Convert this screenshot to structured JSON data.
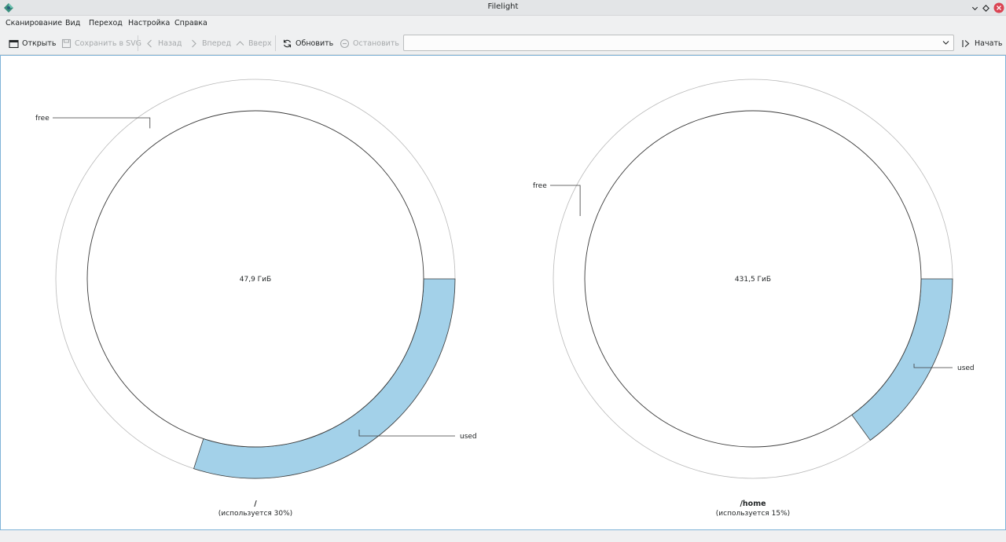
{
  "window": {
    "title": "Filelight",
    "icons": {
      "app": "filelight-app-icon",
      "minimize": "chevron-down-icon",
      "maximize": "diamond-icon",
      "close": "close-icon"
    }
  },
  "menu": {
    "items": [
      "Сканирование",
      "Вид",
      "Переход",
      "Настройка",
      "Справка"
    ]
  },
  "toolbar": {
    "open": "Открыть",
    "save_svg": "Сохранить в SVG",
    "back": "Назад",
    "forward": "Вперед",
    "up": "Вверх",
    "refresh": "Обновить",
    "stop": "Остановить",
    "start": "Начать",
    "location_value": "",
    "location_placeholder": ""
  },
  "colors": {
    "used_fill": "#a3d1e9",
    "ring_stroke": "#3b3b3b",
    "outer_ring": "#b8b8b8",
    "frame_border": "#7fb3d8"
  },
  "disks": [
    {
      "mount": "/",
      "size_label": "47,9 ГиБ",
      "usage_label": "(используется 30%)",
      "used_fraction": 0.3,
      "free_label": "free",
      "used_label": "used"
    },
    {
      "mount": "/home",
      "size_label": "431,5 ГиБ",
      "usage_label": "(используется 15%)",
      "used_fraction": 0.15,
      "free_label": "free",
      "used_label": "used"
    }
  ]
}
